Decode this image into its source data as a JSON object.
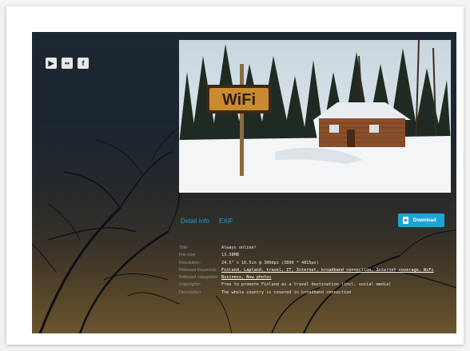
{
  "social": {
    "icons": [
      {
        "name": "youtube-icon",
        "glyph": "▶"
      },
      {
        "name": "flickr-icon",
        "glyph": "••"
      },
      {
        "name": "facebook-icon",
        "glyph": "f"
      }
    ]
  },
  "photo": {
    "sign_text": "WiFi"
  },
  "tabs": {
    "detail_info": "Detail Info",
    "exif": "EXIF"
  },
  "download": {
    "label": "Download"
  },
  "details": [
    {
      "label": "Title:",
      "value": "Always online!"
    },
    {
      "label": "File size:",
      "value": "13.38MB"
    },
    {
      "label": "Resolution:",
      "value": "24.5\" x 16.5in @ 300dpi (3800 * 4815px)"
    },
    {
      "label": "Relevant Keywords:",
      "value": "Finland, Lapland, travel, IT, Internet, broadband connection, Internet coverage, WiFi"
    },
    {
      "label": "Relevant categories:",
      "value": "Business, New photos"
    },
    {
      "label": "Copyrights:",
      "value": "Free to promote Finland as a travel destination (incl. social media)"
    },
    {
      "label": "Description:",
      "value": "The whole country is covered in broadband connection"
    }
  ],
  "colors": {
    "accent": "#1fa4d6"
  }
}
